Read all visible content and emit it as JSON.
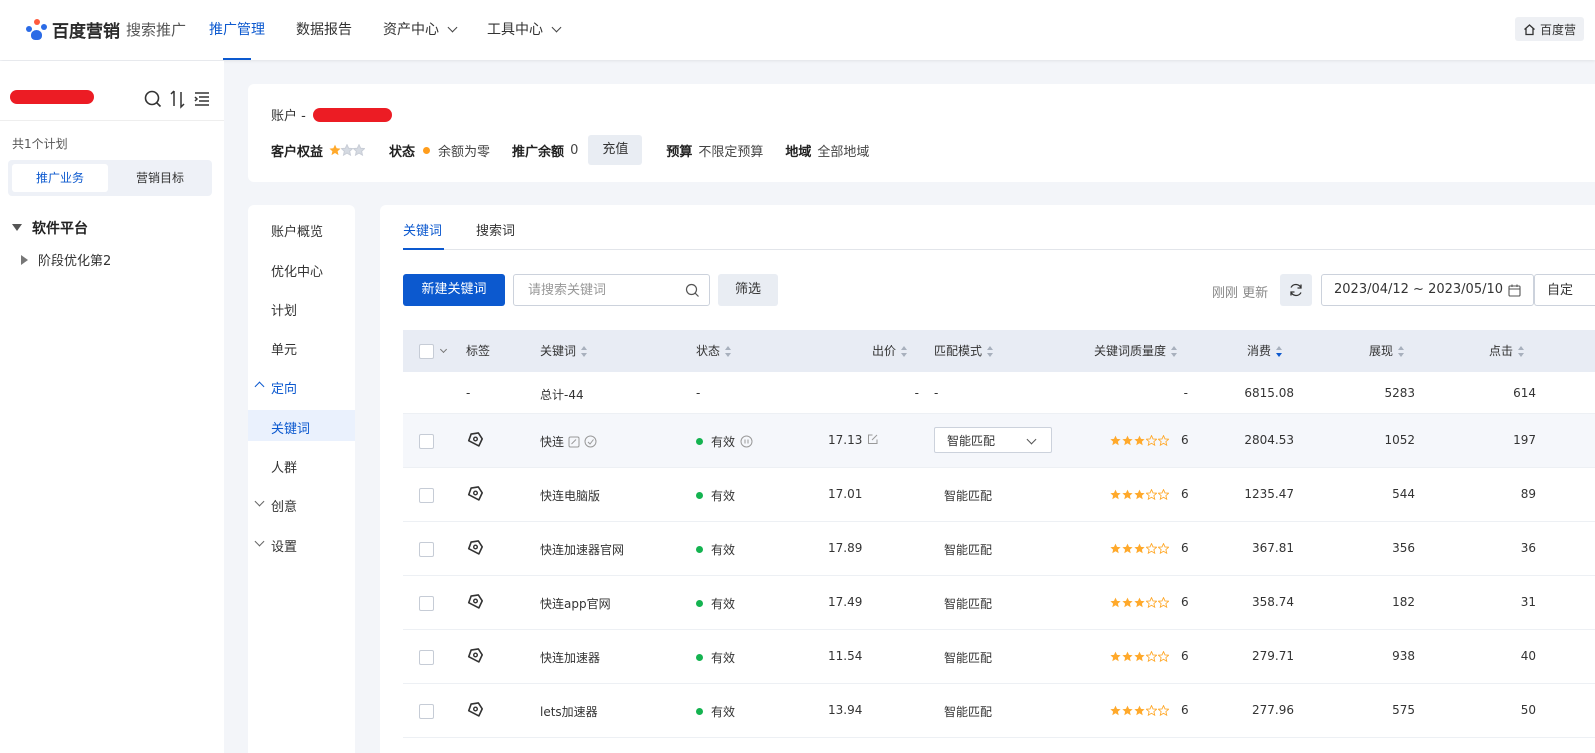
{
  "header": {
    "brand": "百度营销",
    "product": "搜索推广",
    "nav": [
      "推广管理",
      "数据报告",
      "资产中心",
      "工具中心"
    ],
    "home_label": "百度营"
  },
  "sidebar": {
    "plan_count": "共1个计划",
    "segments": [
      "推广业务",
      "营销目标"
    ],
    "tree": {
      "root": "软件平台",
      "child": "阶段优化第2"
    }
  },
  "account": {
    "title_prefix": "账户 -",
    "rights_label": "客户权益",
    "rights_stars": 1,
    "status_label": "状态",
    "status_value": "余额为零",
    "balance_label": "推广余额",
    "balance_value": "0",
    "recharge_label": "充值",
    "budget_label": "预算",
    "budget_value": "不限定预算",
    "region_label": "地域",
    "region_value": "全部地域"
  },
  "menu": {
    "items": [
      "账户概览",
      "优化中心",
      "计划",
      "单元",
      "定向",
      "关键词",
      "人群",
      "创意",
      "设置"
    ]
  },
  "main": {
    "tabs": [
      "关键词",
      "搜索词"
    ],
    "new_keyword_label": "新建关键词",
    "search_placeholder": "请搜索关键词",
    "filter_label": "筛选",
    "updated_text": "刚刚 更新",
    "date_range": "2023/04/12 ~ 2023/05/10",
    "custom_label": "自定"
  },
  "table": {
    "headers": [
      "标签",
      "关键词",
      "状态",
      "出价",
      "匹配模式",
      "关键词质量度",
      "消费",
      "展现",
      "点击"
    ],
    "total": {
      "tag": "-",
      "keyword": "总计-44",
      "status": "-",
      "bid": "-",
      "match": "-",
      "quality": "-",
      "cost": "6815.08",
      "impressions": "5283",
      "clicks": "614"
    },
    "rows": [
      {
        "keyword": "快连",
        "status": "有效",
        "bid": "17.13",
        "match": "智能匹配",
        "quality_stars": 3,
        "quality": "6",
        "cost": "2804.53",
        "impressions": "1052",
        "clicks": "197"
      },
      {
        "keyword": "快连电脑版",
        "status": "有效",
        "bid": "17.01",
        "match": "智能匹配",
        "quality_stars": 3,
        "quality": "6",
        "cost": "1235.47",
        "impressions": "544",
        "clicks": "89"
      },
      {
        "keyword": "快连加速器官网",
        "status": "有效",
        "bid": "17.89",
        "match": "智能匹配",
        "quality_stars": 3,
        "quality": "6",
        "cost": "367.81",
        "impressions": "356",
        "clicks": "36"
      },
      {
        "keyword": "快连app官网",
        "status": "有效",
        "bid": "17.49",
        "match": "智能匹配",
        "quality_stars": 3,
        "quality": "6",
        "cost": "358.74",
        "impressions": "182",
        "clicks": "31"
      },
      {
        "keyword": "快连加速器",
        "status": "有效",
        "bid": "11.54",
        "match": "智能匹配",
        "quality_stars": 3,
        "quality": "6",
        "cost": "279.71",
        "impressions": "938",
        "clicks": "40"
      },
      {
        "keyword": "lets加速器",
        "status": "有效",
        "bid": "13.94",
        "match": "智能匹配",
        "quality_stars": 3,
        "quality": "6",
        "cost": "277.96",
        "impressions": "575",
        "clicks": "50"
      }
    ]
  },
  "colors": {
    "primary": "#0c59cf",
    "star": "#ffa92b",
    "status_ok": "#14b350",
    "status_warn": "#ff9d1c",
    "redaction": "#ec1c24"
  }
}
